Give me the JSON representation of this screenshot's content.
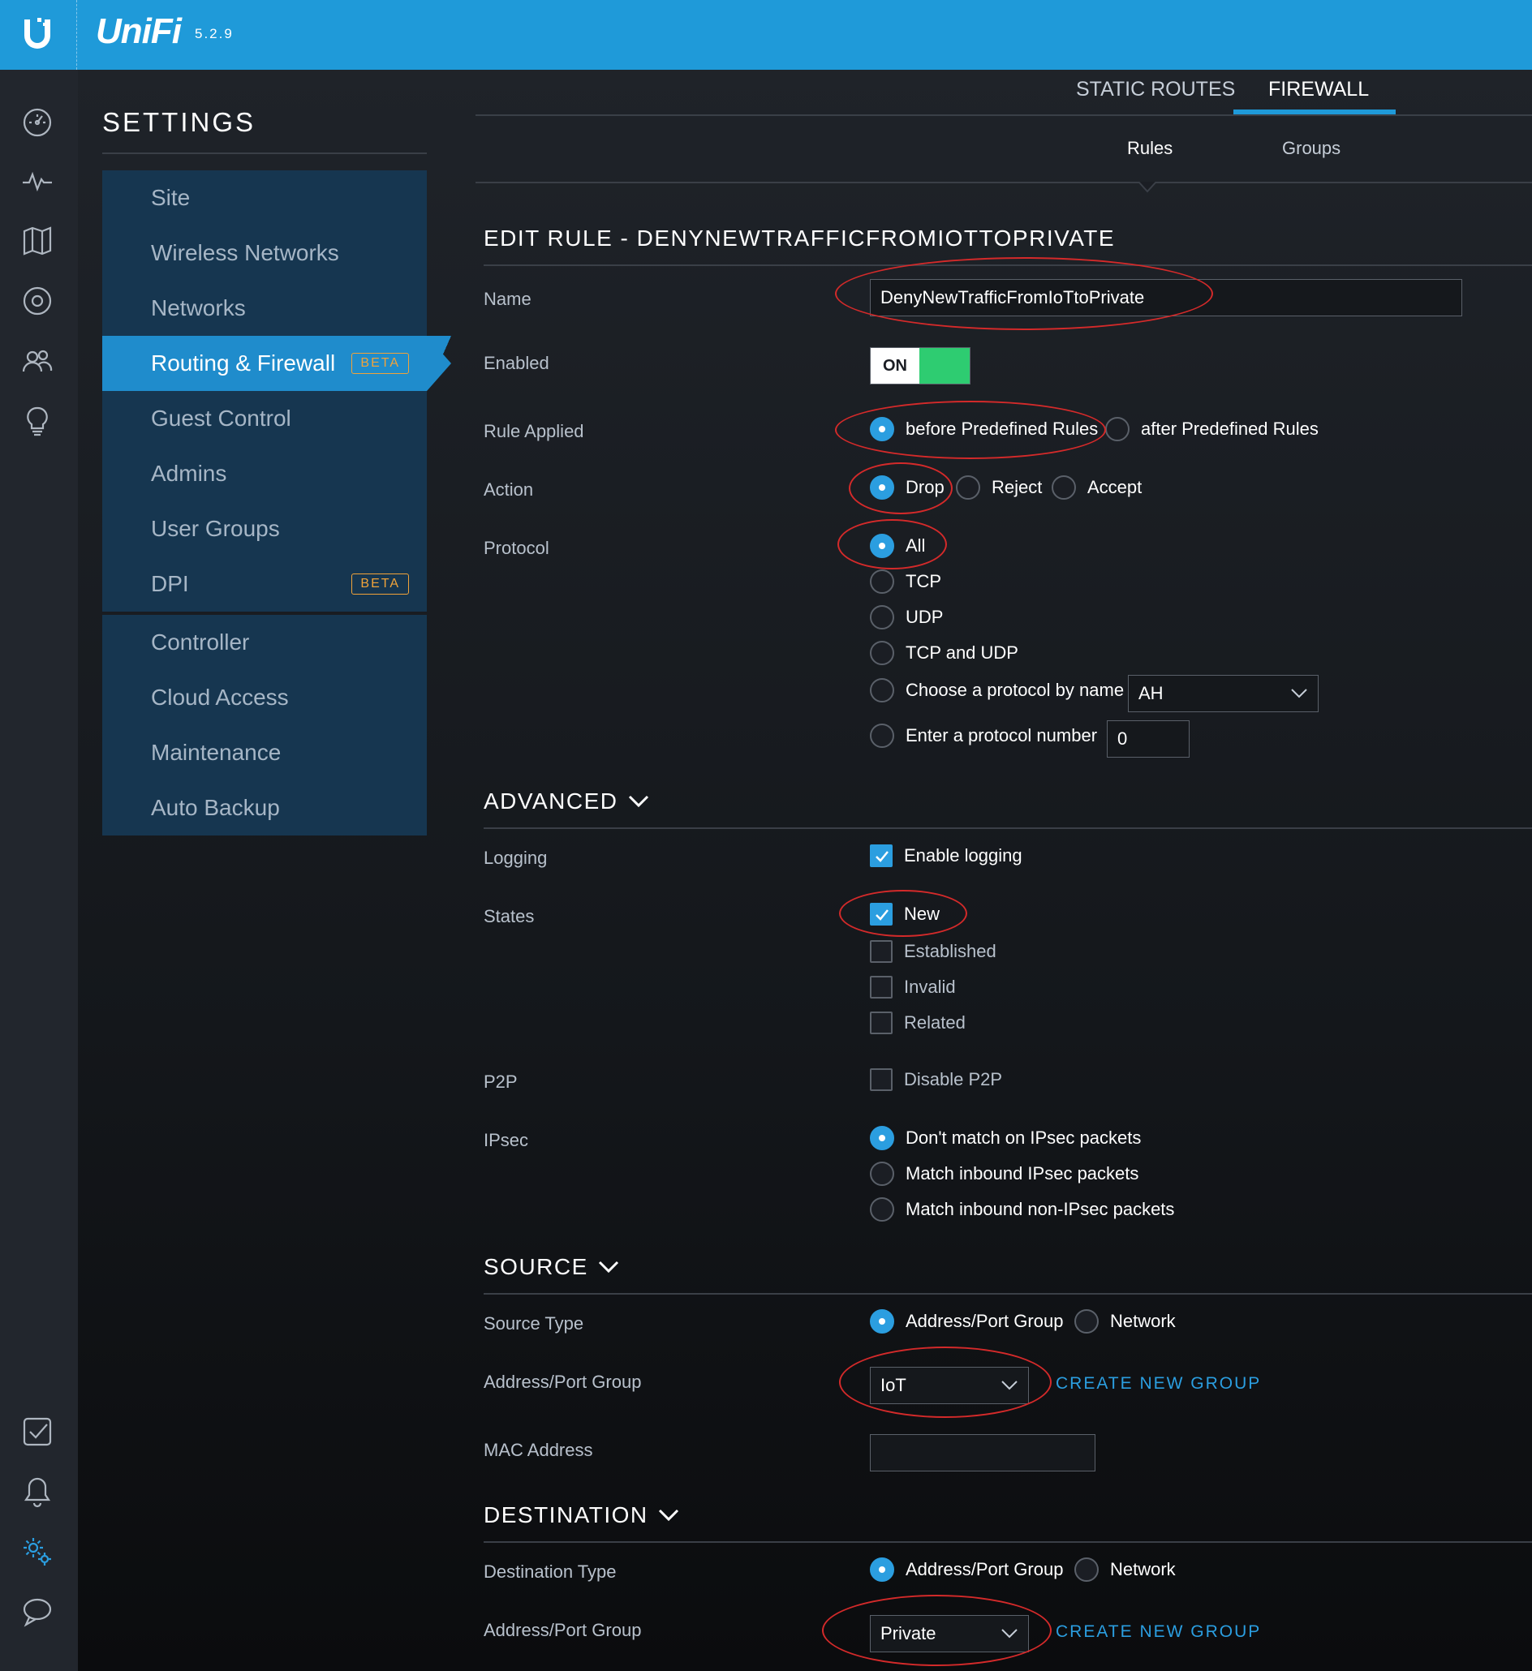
{
  "app": {
    "brand": "UniFi",
    "version": "5.2.9"
  },
  "colors": {
    "topbar": "#1f9ad9",
    "accent": "#2b9ee0",
    "toggle_on": "#2ecc71",
    "beta": "#f0a33a",
    "annotation": "#d42a2a"
  },
  "rail_icons": [
    "dashboard-icon",
    "statistics-icon",
    "map-icon",
    "devices-icon",
    "clients-icon",
    "insights-icon",
    "events-icon",
    "alerts-icon",
    "settings-icon",
    "chat-icon"
  ],
  "settings": {
    "title": "SETTINGS",
    "groups": [
      [
        {
          "label": "Site"
        },
        {
          "label": "Wireless Networks"
        },
        {
          "label": "Networks"
        },
        {
          "label": "Routing & Firewall",
          "badge": "BETA",
          "active": true
        },
        {
          "label": "Guest Control"
        },
        {
          "label": "Admins"
        },
        {
          "label": "User Groups"
        },
        {
          "label": "DPI",
          "badge": "BETA"
        }
      ],
      [
        {
          "label": "Controller"
        },
        {
          "label": "Cloud Access"
        },
        {
          "label": "Maintenance"
        },
        {
          "label": "Auto Backup"
        }
      ]
    ]
  },
  "tabs": {
    "static_routes": "STATIC ROUTES",
    "firewall": "FIREWALL"
  },
  "subtabs": {
    "rules": "Rules",
    "groups": "Groups"
  },
  "edit_rule": {
    "title": "EDIT RULE - DENYNEWTRAFFICFROMIOTTOPRIVATE",
    "name": {
      "label": "Name",
      "value": "DenyNewTrafficFromIoTtoPrivate"
    },
    "enabled": {
      "label": "Enabled",
      "state": "ON"
    },
    "rule_applied": {
      "label": "Rule Applied",
      "before": "before Predefined Rules",
      "after": "after Predefined Rules"
    },
    "action": {
      "label": "Action",
      "drop": "Drop",
      "reject": "Reject",
      "accept": "Accept"
    },
    "protocol": {
      "label": "Protocol",
      "all": "All",
      "tcp": "TCP",
      "udp": "UDP",
      "tcp_udp": "TCP and UDP",
      "by_name": "Choose a protocol by name",
      "by_name_value": "AH",
      "by_number": "Enter a protocol number",
      "by_number_value": "0"
    }
  },
  "advanced": {
    "title": "ADVANCED",
    "logging": {
      "label": "Logging",
      "option": "Enable logging"
    },
    "states": {
      "label": "States",
      "new": "New",
      "established": "Established",
      "invalid": "Invalid",
      "related": "Related"
    },
    "p2p": {
      "label": "P2P",
      "option": "Disable P2P"
    },
    "ipsec": {
      "label": "IPsec",
      "dont": "Don't match on IPsec packets",
      "inbound": "Match inbound IPsec packets",
      "non": "Match inbound non-IPsec packets"
    }
  },
  "source": {
    "title": "SOURCE",
    "type_label": "Source Type",
    "opt_group": "Address/Port Group",
    "opt_network": "Network",
    "group_label": "Address/Port Group",
    "group_value": "IoT",
    "create": "CREATE NEW GROUP",
    "mac_label": "MAC Address",
    "mac_value": ""
  },
  "destination": {
    "title": "DESTINATION",
    "type_label": "Destination Type",
    "opt_group": "Address/Port Group",
    "opt_network": "Network",
    "group_label": "Address/Port Group",
    "group_value": "Private",
    "create": "CREATE NEW GROUP"
  }
}
